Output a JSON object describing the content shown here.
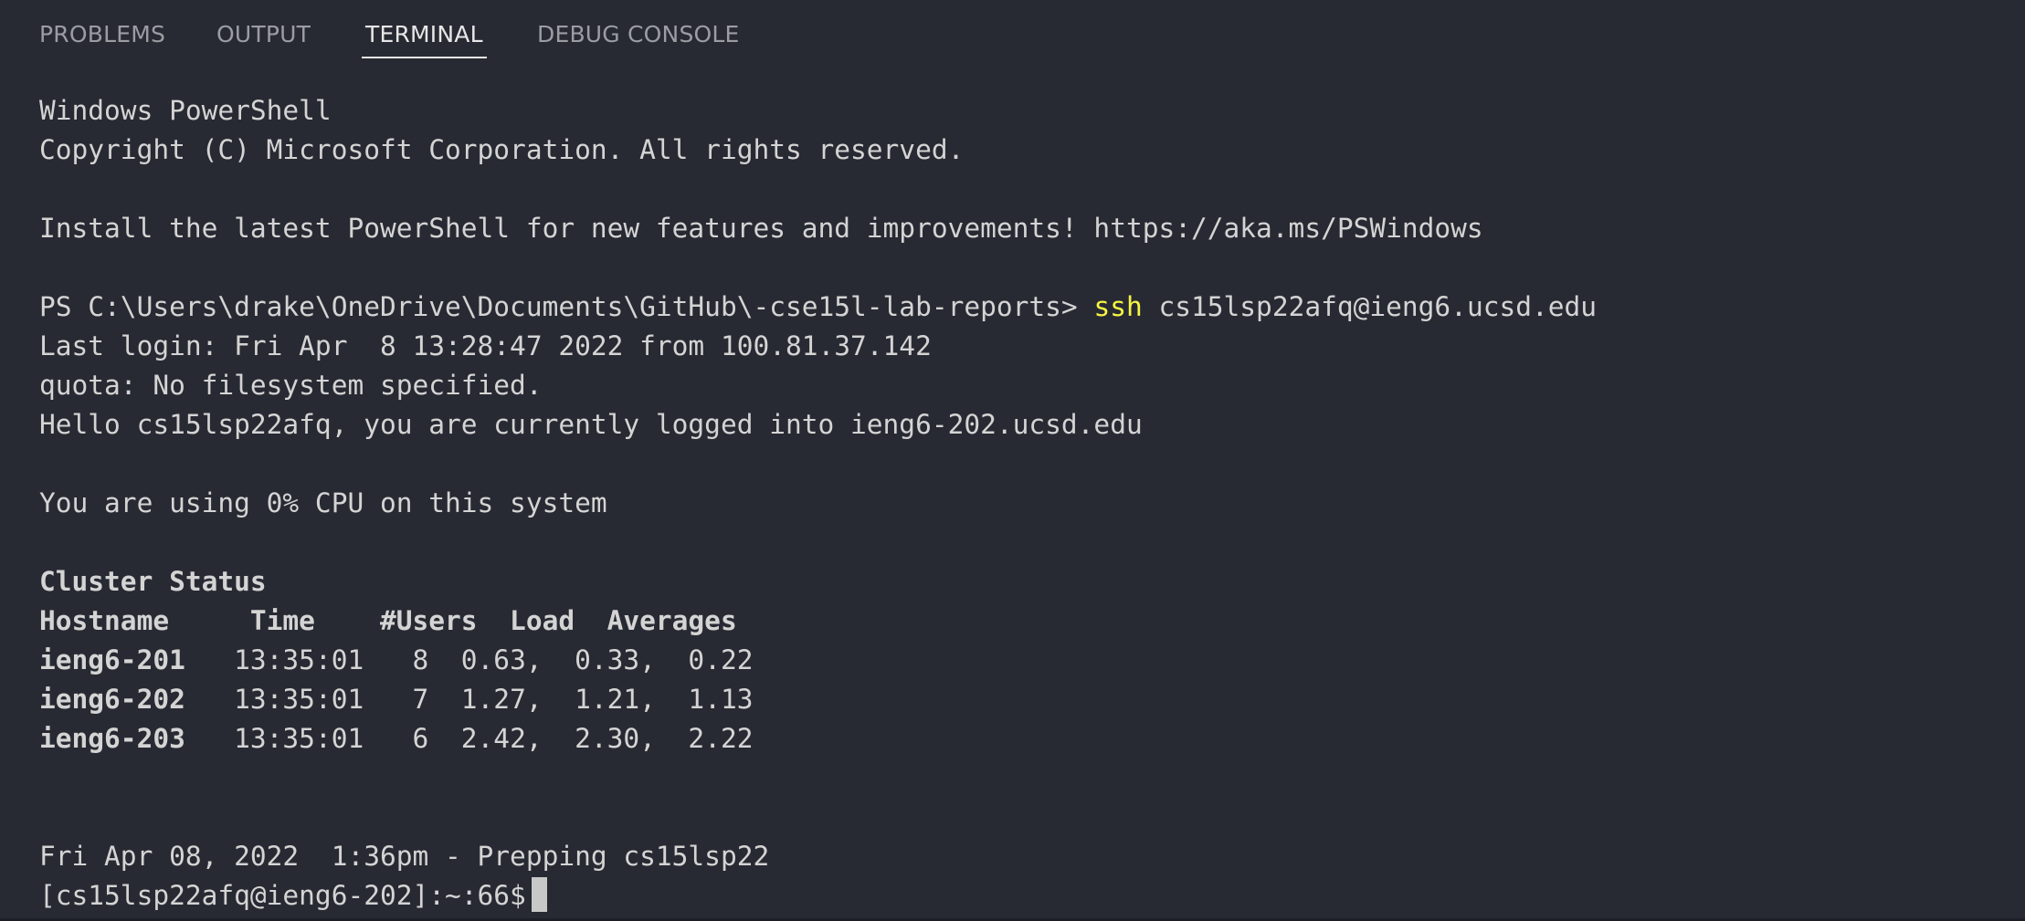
{
  "tabs": [
    {
      "label": "PROBLEMS",
      "active": false
    },
    {
      "label": "OUTPUT",
      "active": false
    },
    {
      "label": "TERMINAL",
      "active": true
    },
    {
      "label": "DEBUG CONSOLE",
      "active": false
    }
  ],
  "terminal": {
    "banner_line1": "Windows PowerShell",
    "banner_line2": "Copyright (C) Microsoft Corporation. All rights reserved.",
    "install_notice": "Install the latest PowerShell for new features and improvements! https://aka.ms/PSWindows",
    "ps_prompt": "PS C:\\Users\\drake\\OneDrive\\Documents\\GitHub\\-cse15l-lab-reports> ",
    "ssh_command": "ssh",
    "ssh_args": " cs15lsp22afq@ieng6.ucsd.edu",
    "last_login": "Last login: Fri Apr  8 13:28:47 2022 from 100.81.37.142",
    "quota": "quota: No filesystem specified.",
    "hello": "Hello cs15lsp22afq, you are currently logged into ieng6-202.ucsd.edu",
    "cpu_usage": "You are using 0% CPU on this system",
    "cluster_title": "Cluster Status",
    "cluster_header": "Hostname     Time    #Users  Load  Averages",
    "cluster_rows": [
      {
        "host": "ieng6-201",
        "rest": "   13:35:01   8  0.63,  0.33,  0.22"
      },
      {
        "host": "ieng6-202",
        "rest": "   13:35:01   7  1.27,  1.21,  1.13"
      },
      {
        "host": "ieng6-203",
        "rest": "   13:35:01   6  2.42,  2.30,  2.22"
      }
    ],
    "prep_line": "Fri Apr 08, 2022  1:36pm - Prepping cs15lsp22",
    "shell_prompt": "[cs15lsp22afq@ieng6-202]:~:66$"
  }
}
